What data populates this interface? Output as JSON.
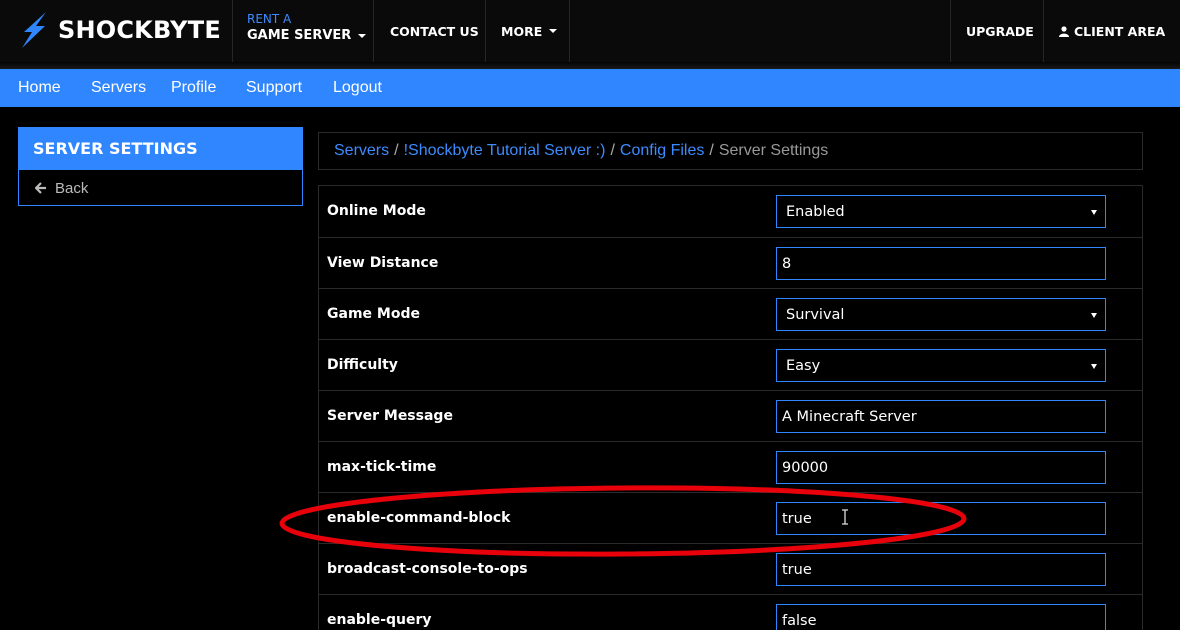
{
  "header": {
    "logo_text": "SHOCKBYTE",
    "logo_icon": "lightning-bolt-icon",
    "rent_small": "RENT A",
    "rent_big": "GAME SERVER",
    "contact": "CONTACT US",
    "more": "MORE",
    "upgrade": "UPGRADE",
    "client_area": "CLIENT AREA"
  },
  "subnav": {
    "items": [
      "Home",
      "Servers",
      "Profile",
      "Support",
      "Logout"
    ]
  },
  "side": {
    "title": "SERVER SETTINGS",
    "back": "Back"
  },
  "breadcrumb": {
    "items": [
      "Servers",
      "!Shockbyte Tutorial Server :)",
      "Config Files"
    ],
    "current": "Server Settings",
    "separator": "/"
  },
  "settings": [
    {
      "label": "Online Mode",
      "type": "select",
      "value": "Enabled"
    },
    {
      "label": "View Distance",
      "type": "text",
      "value": "8"
    },
    {
      "label": "Game Mode",
      "type": "select",
      "value": "Survival"
    },
    {
      "label": "Difficulty",
      "type": "select",
      "value": "Easy"
    },
    {
      "label": "Server Message",
      "type": "text",
      "value": "A Minecraft Server"
    },
    {
      "label": "max-tick-time",
      "type": "text",
      "value": "90000"
    },
    {
      "label": "enable-command-block",
      "type": "text",
      "value": "true"
    },
    {
      "label": "broadcast-console-to-ops",
      "type": "text",
      "value": "true"
    },
    {
      "label": "enable-query",
      "type": "text",
      "value": "false"
    }
  ],
  "colors": {
    "accent": "#2f86ff",
    "highlight": "#e8000a",
    "background": "#000000"
  }
}
